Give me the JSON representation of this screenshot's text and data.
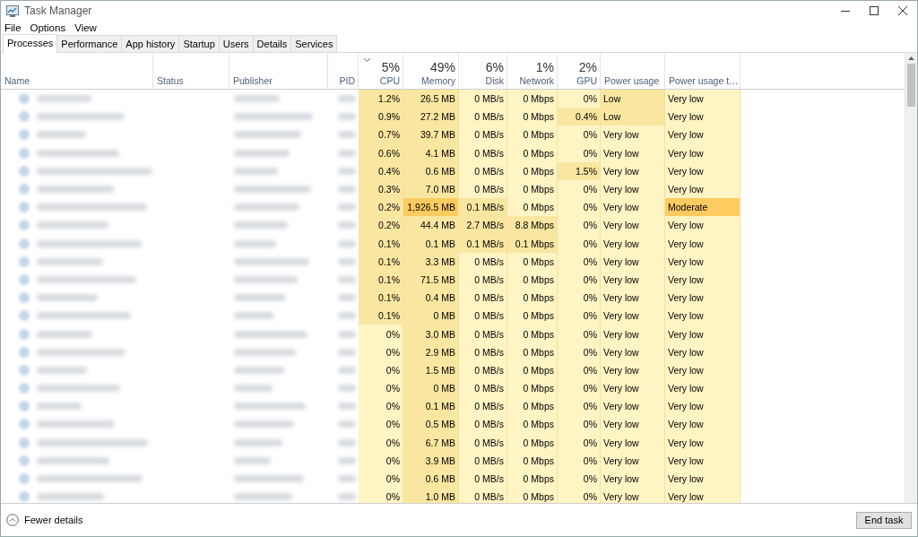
{
  "window": {
    "title": "Task Manager"
  },
  "menu": [
    "File",
    "Options",
    "View"
  ],
  "tabs": [
    {
      "label": "Processes",
      "selected": true
    },
    {
      "label": "Performance",
      "selected": false
    },
    {
      "label": "App history",
      "selected": false
    },
    {
      "label": "Startup",
      "selected": false
    },
    {
      "label": "Users",
      "selected": false
    },
    {
      "label": "Details",
      "selected": false
    },
    {
      "label": "Services",
      "selected": false
    }
  ],
  "columns": [
    {
      "label": "Name",
      "kind": "text",
      "sorted": false
    },
    {
      "label": "Status",
      "kind": "text",
      "sorted": false
    },
    {
      "label": "Publisher",
      "kind": "text",
      "sorted": false
    },
    {
      "label": "PID",
      "kind": "id",
      "sorted": false
    },
    {
      "label": "CPU",
      "usage": "5%",
      "kind": "metric",
      "sorted": true
    },
    {
      "label": "Memory",
      "usage": "49%",
      "kind": "metric",
      "sorted": false
    },
    {
      "label": "Disk",
      "usage": "6%",
      "kind": "metric",
      "sorted": false
    },
    {
      "label": "Network",
      "usage": "1%",
      "kind": "metric",
      "sorted": false
    },
    {
      "label": "GPU",
      "usage": "2%",
      "kind": "metric",
      "sorted": false
    },
    {
      "label": "Power usage",
      "kind": "power",
      "sorted": false
    },
    {
      "label": "Power usage t…",
      "kind": "power",
      "sorted": false
    }
  ],
  "rows": [
    {
      "cells": [
        {
          "text": "1.2%",
          "color": "#f9e6a0"
        },
        {
          "text": "26.5 MB",
          "color": "#f9e6a0"
        },
        {
          "text": "0 MB/s",
          "color": "#fff4c4"
        },
        {
          "text": "0 Mbps",
          "color": "#fff4c4"
        },
        {
          "text": "0%",
          "color": "#fff4c4"
        },
        {
          "text": "Low",
          "color": "#f9e6a0"
        },
        {
          "text": "Very low",
          "color": "#fff4c4"
        }
      ]
    },
    {
      "cells": [
        {
          "text": "0.9%",
          "color": "#f9e6a0"
        },
        {
          "text": "27.2 MB",
          "color": "#f9e6a0"
        },
        {
          "text": "0 MB/s",
          "color": "#fff4c4"
        },
        {
          "text": "0 Mbps",
          "color": "#fff4c4"
        },
        {
          "text": "0.4%",
          "color": "#f9e6a0"
        },
        {
          "text": "Low",
          "color": "#f9e6a0"
        },
        {
          "text": "Very low",
          "color": "#fff4c4"
        }
      ]
    },
    {
      "cells": [
        {
          "text": "0.7%",
          "color": "#f9e6a0"
        },
        {
          "text": "39.7 MB",
          "color": "#f9e6a0"
        },
        {
          "text": "0 MB/s",
          "color": "#fff4c4"
        },
        {
          "text": "0 Mbps",
          "color": "#fff4c4"
        },
        {
          "text": "0%",
          "color": "#fff4c4"
        },
        {
          "text": "Very low",
          "color": "#fff4c4"
        },
        {
          "text": "Very low",
          "color": "#fff4c4"
        }
      ]
    },
    {
      "cells": [
        {
          "text": "0.6%",
          "color": "#f9e6a0"
        },
        {
          "text": "4.1 MB",
          "color": "#f9e6a0"
        },
        {
          "text": "0 MB/s",
          "color": "#fff4c4"
        },
        {
          "text": "0 Mbps",
          "color": "#fff4c4"
        },
        {
          "text": "0%",
          "color": "#fff4c4"
        },
        {
          "text": "Very low",
          "color": "#fff4c4"
        },
        {
          "text": "Very low",
          "color": "#fff4c4"
        }
      ]
    },
    {
      "cells": [
        {
          "text": "0.4%",
          "color": "#f9e6a0"
        },
        {
          "text": "0.6 MB",
          "color": "#f9e6a0"
        },
        {
          "text": "0 MB/s",
          "color": "#fff4c4"
        },
        {
          "text": "0 Mbps",
          "color": "#fff4c4"
        },
        {
          "text": "1.5%",
          "color": "#f9e6a0"
        },
        {
          "text": "Very low",
          "color": "#fff4c4"
        },
        {
          "text": "Very low",
          "color": "#fff4c4"
        }
      ]
    },
    {
      "cells": [
        {
          "text": "0.3%",
          "color": "#f9e6a0"
        },
        {
          "text": "7.0 MB",
          "color": "#f9e6a0"
        },
        {
          "text": "0 MB/s",
          "color": "#fff4c4"
        },
        {
          "text": "0 Mbps",
          "color": "#fff4c4"
        },
        {
          "text": "0%",
          "color": "#fff4c4"
        },
        {
          "text": "Very low",
          "color": "#fff4c4"
        },
        {
          "text": "Very low",
          "color": "#fff4c4"
        }
      ]
    },
    {
      "cells": [
        {
          "text": "0.2%",
          "color": "#f9e6a0"
        },
        {
          "text": "1,926.5 MB",
          "color": "#fdcb60"
        },
        {
          "text": "0.1 MB/s",
          "color": "#f9e6a0"
        },
        {
          "text": "0 Mbps",
          "color": "#fff4c4"
        },
        {
          "text": "0%",
          "color": "#fff4c4"
        },
        {
          "text": "Very low",
          "color": "#fff4c4"
        },
        {
          "text": "Moderate",
          "color": "#fdcb60"
        }
      ]
    },
    {
      "cells": [
        {
          "text": "0.2%",
          "color": "#f9e6a0"
        },
        {
          "text": "44.4 MB",
          "color": "#f9e6a0"
        },
        {
          "text": "2.7 MB/s",
          "color": "#f9e6a0"
        },
        {
          "text": "8.8 Mbps",
          "color": "#f9e6a0"
        },
        {
          "text": "0%",
          "color": "#fff4c4"
        },
        {
          "text": "Very low",
          "color": "#fff4c4"
        },
        {
          "text": "Very low",
          "color": "#fff4c4"
        }
      ]
    },
    {
      "cells": [
        {
          "text": "0.1%",
          "color": "#f9e6a0"
        },
        {
          "text": "0.1 MB",
          "color": "#f9e6a0"
        },
        {
          "text": "0.1 MB/s",
          "color": "#f9e6a0"
        },
        {
          "text": "0.1 Mbps",
          "color": "#f9e6a0"
        },
        {
          "text": "0%",
          "color": "#fff4c4"
        },
        {
          "text": "Very low",
          "color": "#fff4c4"
        },
        {
          "text": "Very low",
          "color": "#fff4c4"
        }
      ]
    },
    {
      "cells": [
        {
          "text": "0.1%",
          "color": "#f9e6a0"
        },
        {
          "text": "3.3 MB",
          "color": "#f9e6a0"
        },
        {
          "text": "0 MB/s",
          "color": "#fff4c4"
        },
        {
          "text": "0 Mbps",
          "color": "#fff4c4"
        },
        {
          "text": "0%",
          "color": "#fff4c4"
        },
        {
          "text": "Very low",
          "color": "#fff4c4"
        },
        {
          "text": "Very low",
          "color": "#fff4c4"
        }
      ]
    },
    {
      "cells": [
        {
          "text": "0.1%",
          "color": "#f9e6a0"
        },
        {
          "text": "71.5 MB",
          "color": "#f9e6a0"
        },
        {
          "text": "0 MB/s",
          "color": "#fff4c4"
        },
        {
          "text": "0 Mbps",
          "color": "#fff4c4"
        },
        {
          "text": "0%",
          "color": "#fff4c4"
        },
        {
          "text": "Very low",
          "color": "#fff4c4"
        },
        {
          "text": "Very low",
          "color": "#fff4c4"
        }
      ]
    },
    {
      "cells": [
        {
          "text": "0.1%",
          "color": "#f9e6a0"
        },
        {
          "text": "0.4 MB",
          "color": "#f9e6a0"
        },
        {
          "text": "0 MB/s",
          "color": "#fff4c4"
        },
        {
          "text": "0 Mbps",
          "color": "#fff4c4"
        },
        {
          "text": "0%",
          "color": "#fff4c4"
        },
        {
          "text": "Very low",
          "color": "#fff4c4"
        },
        {
          "text": "Very low",
          "color": "#fff4c4"
        }
      ]
    },
    {
      "cells": [
        {
          "text": "0.1%",
          "color": "#f9e6a0"
        },
        {
          "text": "0 MB",
          "color": "#f9e6a0"
        },
        {
          "text": "0 MB/s",
          "color": "#fff4c4"
        },
        {
          "text": "0 Mbps",
          "color": "#fff4c4"
        },
        {
          "text": "0%",
          "color": "#fff4c4"
        },
        {
          "text": "Very low",
          "color": "#fff4c4"
        },
        {
          "text": "Very low",
          "color": "#fff4c4"
        }
      ]
    },
    {
      "cells": [
        {
          "text": "0%",
          "color": "#fff4c4"
        },
        {
          "text": "3.0 MB",
          "color": "#f9e6a0"
        },
        {
          "text": "0 MB/s",
          "color": "#fff4c4"
        },
        {
          "text": "0 Mbps",
          "color": "#fff4c4"
        },
        {
          "text": "0%",
          "color": "#fff4c4"
        },
        {
          "text": "Very low",
          "color": "#fff4c4"
        },
        {
          "text": "Very low",
          "color": "#fff4c4"
        }
      ]
    },
    {
      "cells": [
        {
          "text": "0%",
          "color": "#fff4c4"
        },
        {
          "text": "2.9 MB",
          "color": "#f9e6a0"
        },
        {
          "text": "0 MB/s",
          "color": "#fff4c4"
        },
        {
          "text": "0 Mbps",
          "color": "#fff4c4"
        },
        {
          "text": "0%",
          "color": "#fff4c4"
        },
        {
          "text": "Very low",
          "color": "#fff4c4"
        },
        {
          "text": "Very low",
          "color": "#fff4c4"
        }
      ]
    },
    {
      "cells": [
        {
          "text": "0%",
          "color": "#fff4c4"
        },
        {
          "text": "1.5 MB",
          "color": "#f9e6a0"
        },
        {
          "text": "0 MB/s",
          "color": "#fff4c4"
        },
        {
          "text": "0 Mbps",
          "color": "#fff4c4"
        },
        {
          "text": "0%",
          "color": "#fff4c4"
        },
        {
          "text": "Very low",
          "color": "#fff4c4"
        },
        {
          "text": "Very low",
          "color": "#fff4c4"
        }
      ]
    },
    {
      "cells": [
        {
          "text": "0%",
          "color": "#fff4c4"
        },
        {
          "text": "0 MB",
          "color": "#f9e6a0"
        },
        {
          "text": "0 MB/s",
          "color": "#fff4c4"
        },
        {
          "text": "0 Mbps",
          "color": "#fff4c4"
        },
        {
          "text": "0%",
          "color": "#fff4c4"
        },
        {
          "text": "Very low",
          "color": "#fff4c4"
        },
        {
          "text": "Very low",
          "color": "#fff4c4"
        }
      ]
    },
    {
      "cells": [
        {
          "text": "0%",
          "color": "#fff4c4"
        },
        {
          "text": "0.1 MB",
          "color": "#f9e6a0"
        },
        {
          "text": "0 MB/s",
          "color": "#fff4c4"
        },
        {
          "text": "0 Mbps",
          "color": "#fff4c4"
        },
        {
          "text": "0%",
          "color": "#fff4c4"
        },
        {
          "text": "Very low",
          "color": "#fff4c4"
        },
        {
          "text": "Very low",
          "color": "#fff4c4"
        }
      ]
    },
    {
      "cells": [
        {
          "text": "0%",
          "color": "#fff4c4"
        },
        {
          "text": "0.5 MB",
          "color": "#f9e6a0"
        },
        {
          "text": "0 MB/s",
          "color": "#fff4c4"
        },
        {
          "text": "0 Mbps",
          "color": "#fff4c4"
        },
        {
          "text": "0%",
          "color": "#fff4c4"
        },
        {
          "text": "Very low",
          "color": "#fff4c4"
        },
        {
          "text": "Very low",
          "color": "#fff4c4"
        }
      ]
    },
    {
      "cells": [
        {
          "text": "0%",
          "color": "#fff4c4"
        },
        {
          "text": "6.7 MB",
          "color": "#f9e6a0"
        },
        {
          "text": "0 MB/s",
          "color": "#fff4c4"
        },
        {
          "text": "0 Mbps",
          "color": "#fff4c4"
        },
        {
          "text": "0%",
          "color": "#fff4c4"
        },
        {
          "text": "Very low",
          "color": "#fff4c4"
        },
        {
          "text": "Very low",
          "color": "#fff4c4"
        }
      ]
    },
    {
      "cells": [
        {
          "text": "0%",
          "color": "#fff4c4"
        },
        {
          "text": "3.9 MB",
          "color": "#f9e6a0"
        },
        {
          "text": "0 MB/s",
          "color": "#fff4c4"
        },
        {
          "text": "0 Mbps",
          "color": "#fff4c4"
        },
        {
          "text": "0%",
          "color": "#fff4c4"
        },
        {
          "text": "Very low",
          "color": "#fff4c4"
        },
        {
          "text": "Very low",
          "color": "#fff4c4"
        }
      ]
    },
    {
      "cells": [
        {
          "text": "0%",
          "color": "#fff4c4"
        },
        {
          "text": "0.6 MB",
          "color": "#f9e6a0"
        },
        {
          "text": "0 MB/s",
          "color": "#fff4c4"
        },
        {
          "text": "0 Mbps",
          "color": "#fff4c4"
        },
        {
          "text": "0%",
          "color": "#fff4c4"
        },
        {
          "text": "Very low",
          "color": "#fff4c4"
        },
        {
          "text": "Very low",
          "color": "#fff4c4"
        }
      ]
    },
    {
      "cells": [
        {
          "text": "0%",
          "color": "#fff4c4"
        },
        {
          "text": "1.0 MB",
          "color": "#f9e6a0"
        },
        {
          "text": "0 MB/s",
          "color": "#fff4c4"
        },
        {
          "text": "0 Mbps",
          "color": "#fff4c4"
        },
        {
          "text": "0%",
          "color": "#fff4c4"
        },
        {
          "text": "Very low",
          "color": "#fff4c4"
        },
        {
          "text": "Very low",
          "color": "#fff4c4"
        }
      ]
    }
  ],
  "footer": {
    "toggle": "Fewer details",
    "button": "End task"
  }
}
